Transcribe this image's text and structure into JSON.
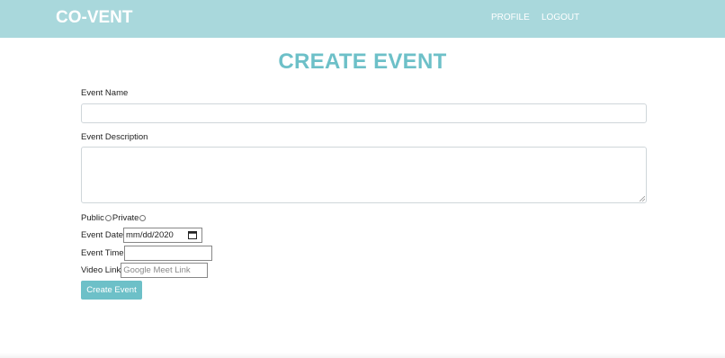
{
  "nav": {
    "brand": "CO-VENT",
    "links": [
      {
        "label": "PROFILE"
      },
      {
        "label": "LOGOUT"
      }
    ]
  },
  "colors": {
    "navbar_bg": "#a9d8dc",
    "accent": "#6dc0c8",
    "text": "#222222"
  },
  "form": {
    "title": "CREATE EVENT",
    "event_name": {
      "label": "Event Name",
      "value": ""
    },
    "event_description": {
      "label": "Event Description",
      "value": ""
    },
    "visibility": {
      "public_label": "Public",
      "private_label": "Private",
      "selected": null
    },
    "event_date": {
      "label": "Event Date",
      "display": "mm/dd/2020",
      "icon": "calendar-icon"
    },
    "event_time": {
      "label": "Event Time",
      "value": ""
    },
    "video_link": {
      "label": "Video Link",
      "placeholder": "Google Meet Link",
      "value": ""
    },
    "submit_label": "Create Event"
  }
}
